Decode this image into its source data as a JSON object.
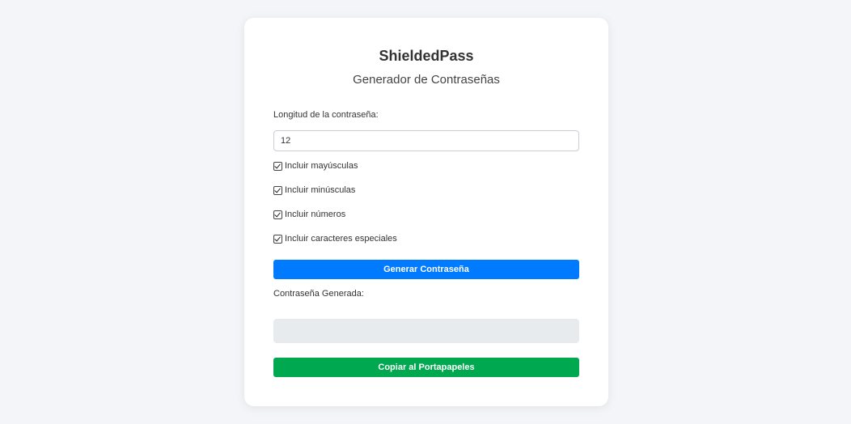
{
  "app": {
    "title": "ShieldedPass",
    "subtitle": "Generador de Contraseñas"
  },
  "form": {
    "length_label": "Longitud de la contraseña:",
    "length_value": "12",
    "options": [
      {
        "label": "Incluir mayúsculas",
        "checked": true
      },
      {
        "label": "Incluir minúsculas",
        "checked": true
      },
      {
        "label": "Incluir números",
        "checked": true
      },
      {
        "label": "Incluir caracteres especiales",
        "checked": true
      }
    ],
    "generate_label": "Generar Contraseña"
  },
  "result": {
    "label": "Contraseña Generada:",
    "value": "",
    "copy_label": "Copiar al Portapapeles"
  },
  "colors": {
    "background": "#f3f5f8",
    "generate_button": "#007bff",
    "copy_button": "#00a84f",
    "output_box": "#e8ebee"
  }
}
